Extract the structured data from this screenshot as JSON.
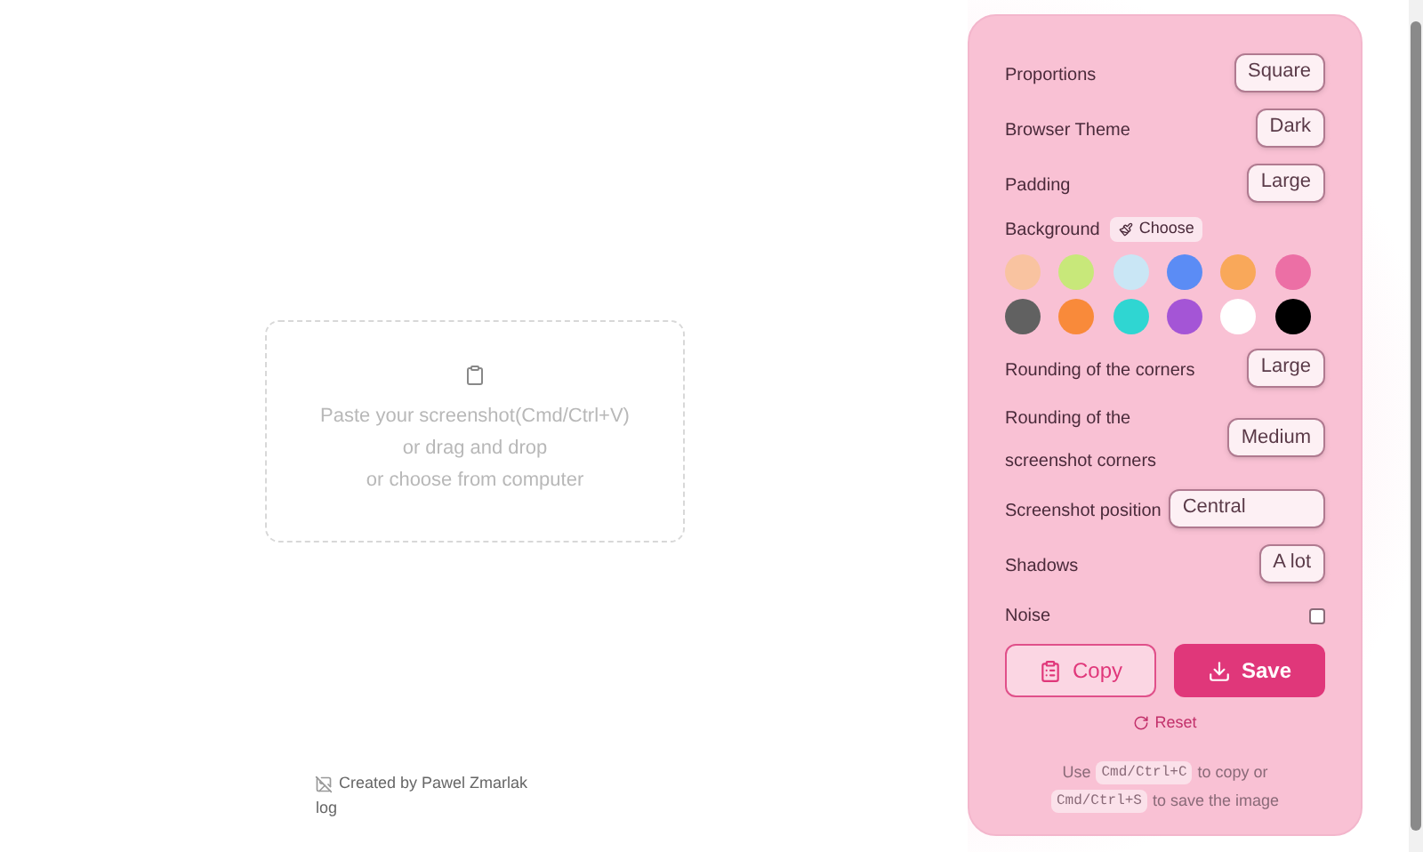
{
  "dropzone": {
    "lines": [
      "Paste your screenshot(Cmd/Ctrl+V)",
      "or drag and drop",
      "or choose from computer"
    ]
  },
  "footer": {
    "image_alt": "log",
    "credit": "Created by Pawel Zmarlak"
  },
  "settings": {
    "rows": [
      {
        "kind": "select",
        "label": "Proportions",
        "value": "Square"
      },
      {
        "kind": "select",
        "label": "Browser Theme",
        "value": "Dark"
      },
      {
        "kind": "select",
        "label": "Padding",
        "value": "Large"
      },
      {
        "kind": "background",
        "label": "Background",
        "button": "Choose",
        "swatches": [
          {
            "color": "#f9c3a0",
            "selected": false
          },
          {
            "color": "#c8e87a",
            "selected": false
          },
          {
            "color": "#c9e6f5",
            "selected": false
          },
          {
            "color": "#5b8cf5",
            "selected": false
          },
          {
            "color": "#f9a85a",
            "selected": false
          },
          {
            "color": "#ec6fa5",
            "selected": false
          },
          {
            "color": "#616161",
            "selected": false
          },
          {
            "color": "#f98a3a",
            "selected": false
          },
          {
            "color": "#2fd6d2",
            "selected": false
          },
          {
            "color": "#a455d6",
            "selected": false
          },
          {
            "color": "#ffffff",
            "selected": false
          },
          {
            "color": "#000000",
            "selected": false
          }
        ]
      },
      {
        "kind": "select",
        "label": "Rounding of the corners",
        "value": "Large"
      },
      {
        "kind": "select",
        "label": "Rounding of the screenshot corners",
        "value": "Medium"
      },
      {
        "kind": "wide-select",
        "label": "Screenshot position",
        "value": "Central"
      },
      {
        "kind": "select",
        "label": "Shadows",
        "value": "A lot"
      },
      {
        "kind": "checkbox",
        "label": "Noise",
        "checked": false
      }
    ],
    "copy_button": "Copy",
    "save_button": "Save",
    "reset_link": "Reset",
    "hint": [
      {
        "kind": "text",
        "text": "Use"
      },
      {
        "kind": "key",
        "text": "Cmd/Ctrl+C"
      },
      {
        "kind": "text",
        "text": "to copy or"
      },
      {
        "kind": "key",
        "text": "Cmd/Ctrl+S"
      },
      {
        "kind": "text",
        "text": "to save the image"
      }
    ]
  }
}
